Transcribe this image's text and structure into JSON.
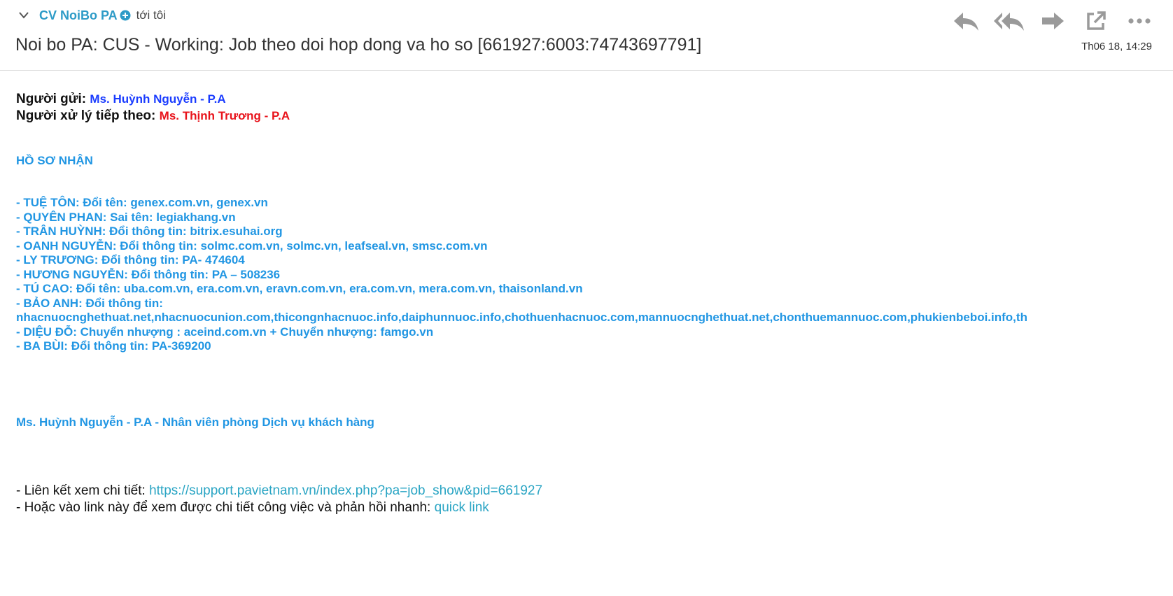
{
  "header": {
    "sender_name": "CV NoiBo PA",
    "recipient_text": "tới tôi",
    "subject": "Noi bo PA: CUS - Working: Job theo doi hop dong va ho so [661927:6003:74743697791]",
    "date": "Th06 18, 14:29"
  },
  "body": {
    "sender_label": "Người gửi:",
    "sender_value": "Ms. Huỳnh Nguyễn - P.A",
    "handler_label": "Người xử lý tiếp theo:",
    "handler_value": "Ms. Thịnh Trương - P.A",
    "section_title": "HỒ SƠ NHẬN",
    "items": [
      "- TUỆ TÔN: Đổi tên: genex.com.vn, genex.vn",
      "- QUYÊN PHAN: Sai tên: legiakhang.vn",
      "- TRÂN HUỲNH: Đổi thông tin: bitrix.esuhai.org",
      "- OANH NGUYỄN: Đổi thông tin: solmc.com.vn, solmc.vn, leafseal.vn, smsc.com.vn",
      "- LY TRƯƠNG: Đổi thông tin: PA- 474604",
      "- HƯƠNG NGUYỄN: Đổi thông tin: PA – 508236",
      "- TÚ CAO: Đổi tên: uba.com.vn, era.com.vn, eravn.com.vn, era.com.vn, mera.com.vn, thaisonland.vn",
      "- BẢO ANH: Đổi thông tin:",
      "nhacnuocnghethuat.net,nhacnuocunion.com,thicongnhacnuoc.info,daiphunnuoc.info,chothuenhacnuoc.com,mannuocnghethuat.net,chonthuemannuoc.com,phukienbeboi.info,th",
      "- DIỆU ĐỖ: Chuyển nhượng : aceind.com.vn + Chuyển nhượng: famgo.vn",
      "- BA BÙI: Đổi thông tin: PA-369200"
    ],
    "signature": "Ms. Huỳnh Nguyễn - P.A - Nhân viên phòng Dịch vụ khách hàng",
    "link_line_1_prefix": "- Liên kết xem chi tiết: ",
    "link_line_1_url": "https://support.pavietnam.vn/index.php?pa=job_show&pid=661927",
    "link_line_2_prefix": "- Hoặc vào link này để xem được chi tiết công việc và phản hồi nhanh: ",
    "link_line_2_text": "quick link"
  },
  "icons": {
    "collapse": "chevron-down-icon",
    "add_contact": "plus-circle-icon",
    "reply": "reply-icon",
    "reply_all": "reply-all-icon",
    "forward": "forward-icon",
    "open_new": "external-link-icon",
    "more": "more-icon"
  },
  "colors": {
    "sender_name": "#2d9bc7",
    "sender_value": "#1a3cff",
    "handler_value": "#e8131b",
    "content_blue": "#2196e3",
    "link": "#2aa5c4",
    "icon_gray": "#9a9a9a"
  }
}
